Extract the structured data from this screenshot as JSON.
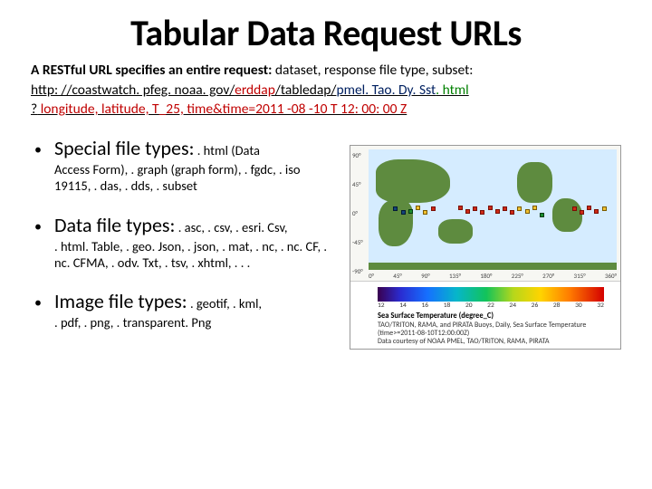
{
  "title": "Tabular Data Request URLs",
  "lede_strong": "A RESTful URL specifies an entire request:",
  "lede_rest": " dataset, response file type, subset:",
  "url": {
    "base": "http: //coastwatch. pfeg. noaa. gov/",
    "erddap": "erddap",
    "sep1": "/",
    "tabledap": "tabledap",
    "sep2": "/",
    "dataset": "pmel. Tao. Dy. Sst",
    "dotext": ". html",
    "qmark": "?",
    "query": " longitude, latitude, T_25, time&time=2011 -08 -10 T 12: 00: 00 Z"
  },
  "bullets": [
    {
      "head": "Special file types:",
      "head_sub": " . html (Data",
      "cont": "Access Form), . graph (graph form), . fgdc, . iso 19115, . das, . dds, . subset"
    },
    {
      "head": "Data file types:",
      "head_sub": " . asc, . csv, . esri. Csv,",
      "cont": ". html. Table, . geo. Json, . json, . mat, . nc, . nc. CF, . nc. CFMA, . odv. Txt, . tsv, . xhtml, . . ."
    },
    {
      "head": "Image file types:",
      "head_sub": " . geotif, . kml,",
      "cont": ". pdf, . png, . transparent. Png"
    }
  ],
  "chart": {
    "lat_ticks": [
      "90°",
      "45°",
      "0°",
      "-45°",
      "-90°"
    ],
    "lon_ticks": [
      "0°",
      "45°",
      "90°",
      "135°",
      "180°",
      "225°",
      "270°",
      "315°",
      "360°"
    ],
    "color_ticks": [
      "12",
      "14",
      "16",
      "18",
      "20",
      "22",
      "24",
      "26",
      "28",
      "30",
      "32"
    ],
    "caption_title": "Sea Surface Temperature (degree_C)",
    "caption_l1": "TAO/TRITON, RAMA, and PIRATA Buoys, Daily, Sea Surface Temperature",
    "caption_l2": "(time>=2011-08-10T12:00:00Z)",
    "caption_l3": "Data courtesy of NOAA PMEL, TAO/TRITON, RAMA, PIRATA"
  }
}
